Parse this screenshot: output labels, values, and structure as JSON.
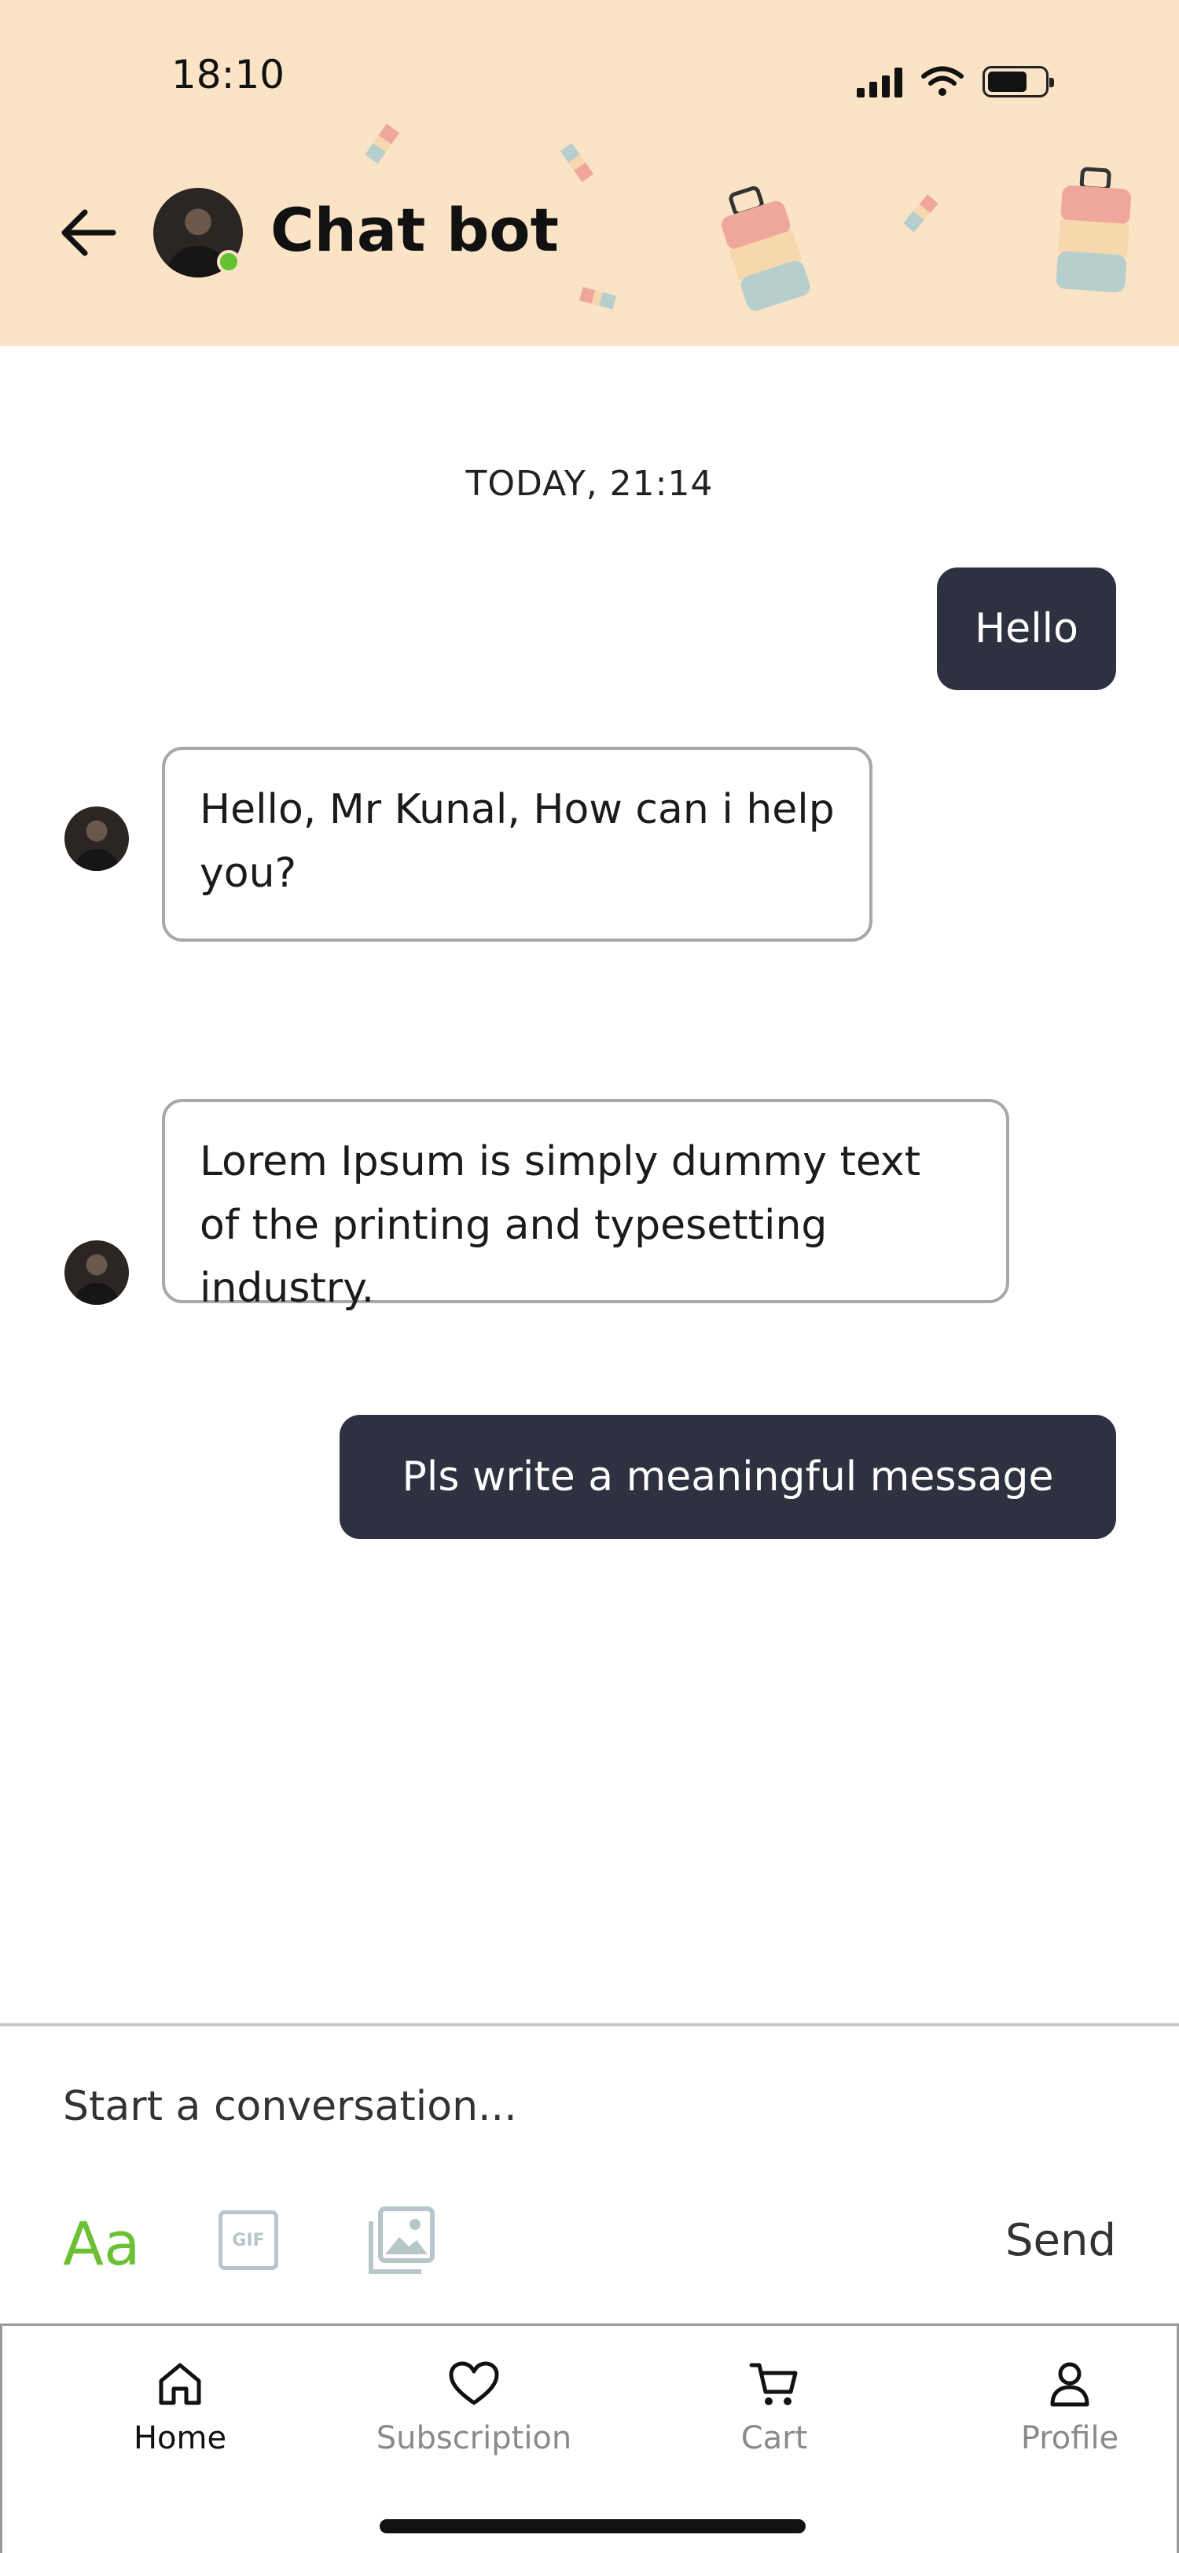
{
  "status_bar": {
    "time": "18:10"
  },
  "header": {
    "title": "Chat bot",
    "background_color": "#fbe3c6",
    "online_status_color": "#63c132"
  },
  "conversation": {
    "timestamp": "TODAY, 21:14",
    "messages": [
      {
        "direction": "outgoing",
        "text": "Hello"
      },
      {
        "direction": "incoming",
        "text": "Hello, Mr Kunal, How can i help you?"
      },
      {
        "direction": "incoming",
        "text": "Lorem Ipsum is simply dummy text of the printing and typesetting industry."
      },
      {
        "direction": "outgoing",
        "text": "Pls write a meaningful message"
      }
    ]
  },
  "composer": {
    "placeholder": "Start a conversation...",
    "format_label": "Aa",
    "gif_label": "GIF",
    "send_label": "Send",
    "accent_color": "#6cc034"
  },
  "bottom_nav": {
    "items": [
      {
        "label": "Home",
        "icon": "home-icon",
        "active": true
      },
      {
        "label": "Subscription",
        "icon": "heart-icon",
        "active": false
      },
      {
        "label": "Cart",
        "icon": "cart-icon",
        "active": false
      },
      {
        "label": "Profile",
        "icon": "profile-icon",
        "active": false
      }
    ]
  },
  "colors": {
    "outgoing_bubble": "#2f3040",
    "incoming_border": "#a8a8a8"
  }
}
